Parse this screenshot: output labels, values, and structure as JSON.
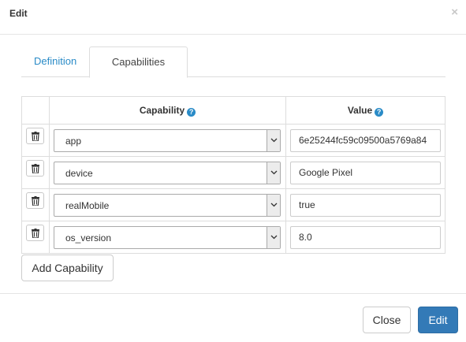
{
  "header": {
    "title": "Edit",
    "close_glyph": "×"
  },
  "tabs": [
    {
      "label": "Definition",
      "active": false
    },
    {
      "label": "Capabilities",
      "active": true
    }
  ],
  "table": {
    "headers": {
      "capability": "Capability",
      "value": "Value"
    },
    "help_glyph": "?",
    "rows": [
      {
        "capability": "app",
        "value": "6e25244fc59c09500a5769a84"
      },
      {
        "capability": "device",
        "value": "Google Pixel"
      },
      {
        "capability": "realMobile",
        "value": "true"
      },
      {
        "capability": "os_version",
        "value": "8.0"
      }
    ]
  },
  "add_button": "Add Capability",
  "footer": {
    "close_label": "Close",
    "edit_label": "Edit"
  },
  "colors": {
    "accent": "#337ab7",
    "link": "#2a8bc7",
    "border": "#dddddd"
  },
  "icons": {
    "close": "close-icon",
    "help": "help-icon",
    "delete": "trash-icon",
    "dropdown": "chevron-down-icon"
  }
}
